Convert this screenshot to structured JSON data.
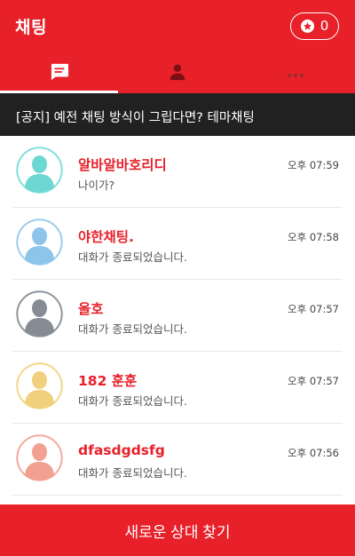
{
  "header": {
    "title": "채팅",
    "points": "0"
  },
  "tabs": [
    {
      "icon": "chat-bubble-icon",
      "active": true
    },
    {
      "icon": "person-icon",
      "active": false
    },
    {
      "icon": "more-dots-icon",
      "active": false
    }
  ],
  "notice": "[공지] 예전 채팅 방식이 그립다면? 테마채팅",
  "chats": [
    {
      "name": "알바알바호리디",
      "message": "나이가?",
      "time": "오후 07:59",
      "avatar_color": "#6dd8d2",
      "ring_color": "#7ee0da"
    },
    {
      "name": "야한채팅.",
      "message": "대화가 종료되었습니다.",
      "time": "오후 07:58",
      "avatar_color": "#8cc4ea",
      "ring_color": "#9accef"
    },
    {
      "name": "올호",
      "message": "대화가 종료되었습니다.",
      "time": "오후 07:57",
      "avatar_color": "#858c94",
      "ring_color": "#8d949b"
    },
    {
      "name": "182 훈훈",
      "message": "대화가 종료되었습니다.",
      "time": "오후 07:57",
      "avatar_color": "#f0d07c",
      "ring_color": "#f2d688"
    },
    {
      "name": "dfasdgdsfg",
      "message": "대화가 종료되었습니다.",
      "time": "오후 07:56",
      "avatar_color": "#f1a092",
      "ring_color": "#f3a99d"
    }
  ],
  "bottom_button": "새로운 상대 찾기",
  "colors": {
    "accent": "#e8202a",
    "notice_bg": "#212121"
  }
}
